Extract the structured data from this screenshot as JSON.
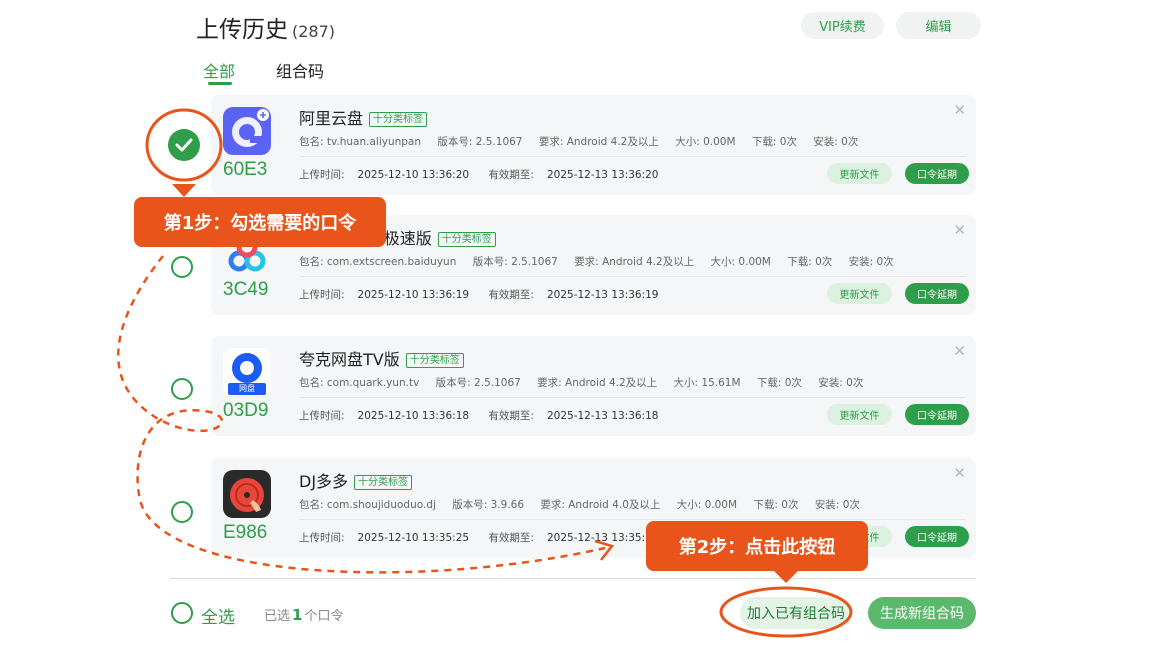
{
  "header": {
    "title": "上传历史",
    "count": "(287)",
    "vip_label": "VIP续费",
    "edit_label": "编辑"
  },
  "tabs": [
    {
      "label": "全部",
      "active": true
    },
    {
      "label": "组合码",
      "active": false
    }
  ],
  "items": [
    {
      "name": "阿里云盘",
      "tag": "十分类标签",
      "code": "60E3",
      "package": "包名: tv.huan.aliyunpan",
      "version": "版本号: 2.5.1067",
      "requirement": "要求: Android 4.2及以上",
      "size": "大小: 0.00M",
      "downloads": "下载: 0次",
      "installs": "安装: 0次",
      "upload_label": "上传时间:",
      "upload_time": "2025-12-10 13:36:20",
      "valid_label": "有效期至:",
      "valid_until": "2025-12-13 13:36:20",
      "update_label": "更新文件",
      "extend_label": "口令延期",
      "selected": true,
      "icon": "aliyunpan-icon"
    },
    {
      "name": "百度网盘TV极速版",
      "tag": "十分类标签",
      "code": "3C49",
      "package": "包名: com.extscreen.baiduyun",
      "version": "版本号: 2.5.1067",
      "requirement": "要求: Android 4.2及以上",
      "size": "大小: 0.00M",
      "downloads": "下载: 0次",
      "installs": "安装: 0次",
      "upload_label": "上传时间:",
      "upload_time": "2025-12-10 13:36:19",
      "valid_label": "有效期至:",
      "valid_until": "2025-12-13 13:36:19",
      "update_label": "更新文件",
      "extend_label": "口令延期",
      "selected": false,
      "icon": "baidu-netdisk-icon"
    },
    {
      "name": "夸克网盘TV版",
      "tag": "十分类标签",
      "code": "03D9",
      "package": "包名: com.quark.yun.tv",
      "version": "版本号: 2.5.1067",
      "requirement": "要求: Android 4.2及以上",
      "size": "大小: 15.61M",
      "downloads": "下载: 0次",
      "installs": "安装: 0次",
      "upload_label": "上传时间:",
      "upload_time": "2025-12-10 13:36:18",
      "valid_label": "有效期至:",
      "valid_until": "2025-12-13 13:36:18",
      "update_label": "更新文件",
      "extend_label": "口令延期",
      "selected": false,
      "icon": "quark-netdisk-icon",
      "icon_caption": "网盘"
    },
    {
      "name": "DJ多多",
      "tag": "十分类标签",
      "code": "E986",
      "package": "包名: com.shoujiduoduo.dj",
      "version": "版本号: 3.9.66",
      "requirement": "要求: Android 4.0及以上",
      "size": "大小: 0.00M",
      "downloads": "下载: 0次",
      "installs": "安装: 0次",
      "upload_label": "上传时间:",
      "upload_time": "2025-12-10 13:35:25",
      "valid_label": "有效期至:",
      "valid_until": "2025-12-13 13:35:25",
      "update_label": "更新文件",
      "extend_label": "口令延期",
      "selected": false,
      "icon": "dj-duoduo-icon"
    }
  ],
  "footer": {
    "select_all_label": "全选",
    "selected_prefix": "已选",
    "selected_count": "1",
    "selected_suffix": "个口令",
    "join_label": "加入已有组合码",
    "new_label": "生成新组合码"
  },
  "annotations": {
    "step1": "第1步：勾选需要的口令",
    "step2": "第2步：点击此按钮",
    "accent_color": "#e8541a"
  },
  "colors": {
    "brand_green": "#2e9e4a",
    "card_bg": "#f5f6f7"
  }
}
